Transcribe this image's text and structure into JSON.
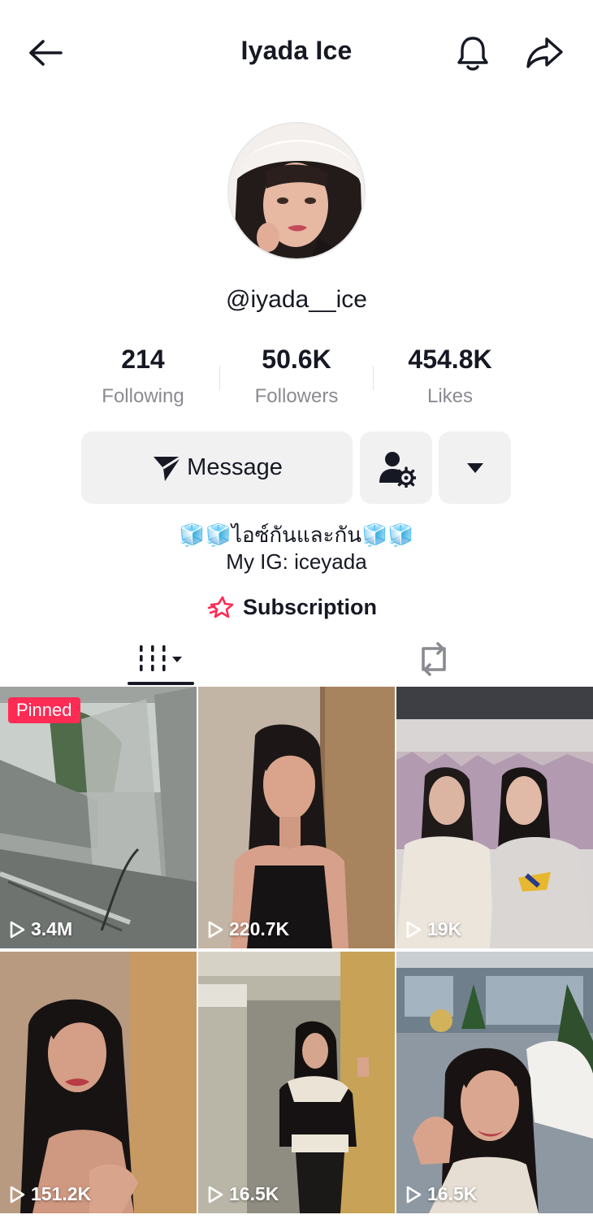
{
  "header": {
    "title": "Iyada Ice",
    "back_icon": "arrow-left-icon",
    "bell_icon": "bell-icon",
    "share_icon": "share-arrow-icon"
  },
  "profile": {
    "avatar_icon": "avatar",
    "handle": "@iyada__ice"
  },
  "stats": [
    {
      "value": "214",
      "label": "Following"
    },
    {
      "value": "50.6K",
      "label": "Followers"
    },
    {
      "value": "454.8K",
      "label": "Likes"
    }
  ],
  "actions": {
    "message_label": "Message",
    "message_icon": "send-plane-icon",
    "follow_settings_icon": "user-settings-icon",
    "more_icon": "caret-down-icon"
  },
  "bio": {
    "line1": "🧊🧊ไอซ์กันและกัน🧊🧊",
    "line2": "My IG: iceyada"
  },
  "subscription": {
    "label": "Subscription",
    "icon": "star-badge-icon",
    "icon_color": "#fe2c55"
  },
  "tabs": [
    {
      "name": "videos",
      "icon": "grid-bars-icon",
      "active": true
    },
    {
      "name": "reposts",
      "icon": "repost-icon",
      "active": false
    }
  ],
  "videos": [
    {
      "views": "3.4M",
      "pinned": true,
      "pinned_label": "Pinned"
    },
    {
      "views": "220.7K",
      "pinned": false
    },
    {
      "views": "19K",
      "pinned": false
    },
    {
      "views": "151.2K",
      "pinned": false
    },
    {
      "views": "16.5K",
      "pinned": false
    },
    {
      "views": "16.5K",
      "pinned": false
    }
  ],
  "colors": {
    "accent": "#fe2c55",
    "text": "#161823",
    "muted": "#8a8b91",
    "button_bg": "#f1f1f2"
  }
}
